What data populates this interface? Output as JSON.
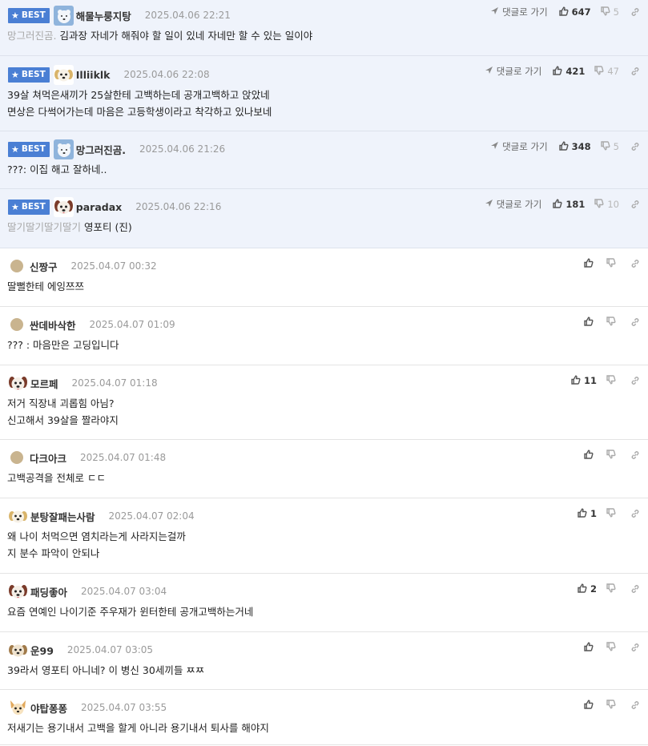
{
  "best_label": "BEST",
  "reply_label": "댓글로 가기",
  "comments": [
    {
      "best": true,
      "avatar": "polar-bear",
      "nickname": "해물누룽지탕",
      "date": "2025.04.06 22:21",
      "up": "647",
      "down": "5",
      "ref": "망그러진곰.",
      "lines": [
        "김과장 자네가 해줘야 할 일이 있네 자네만 할 수 있는 일이야"
      ]
    },
    {
      "best": true,
      "avatar": "puppy-white",
      "nickname": "Illiiklk",
      "date": "2025.04.06 22:08",
      "up": "421",
      "down": "47",
      "ref": "",
      "lines": [
        "39살 쳐먹은새끼가 25살한테 고백하는데 공개고백하고 앉았네",
        "면상은 다썩어가는데 마음은 고등학생이라고 착각하고 있나보네"
      ]
    },
    {
      "best": true,
      "avatar": "polar-bear",
      "nickname": "망그러진곰.",
      "date": "2025.04.06 21:26",
      "up": "348",
      "down": "5",
      "ref": "",
      "lines": [
        "???: 이집 해고 잘하네.."
      ]
    },
    {
      "best": true,
      "avatar": "dog-face",
      "nickname": "paradax",
      "date": "2025.04.06 22:16",
      "up": "181",
      "down": "10",
      "ref": "딸기딸기딸기딸기",
      "lines": [
        "영포티 (진)"
      ]
    },
    {
      "best": false,
      "avatar": "dot",
      "nickname": "신짱구",
      "date": "2025.04.07 00:32",
      "up": "",
      "down": "",
      "ref": "",
      "lines": [
        "딸뻘한테 에잉쯔쯔"
      ]
    },
    {
      "best": false,
      "avatar": "dot",
      "nickname": "싼데바삭한",
      "date": "2025.04.07 01:09",
      "up": "",
      "down": "",
      "ref": "",
      "lines": [
        "??? : 마음만은 고딩입니다"
      ]
    },
    {
      "best": false,
      "avatar": "dog-face",
      "nickname": "모르페",
      "date": "2025.04.07 01:18",
      "up": "11",
      "down": "",
      "ref": "",
      "lines": [
        "저거 직장내 괴롭힘 아님?",
        "신고해서 39살을 짤라야지"
      ]
    },
    {
      "best": false,
      "avatar": "dot",
      "nickname": "다크아크",
      "date": "2025.04.07 01:48",
      "up": "",
      "down": "",
      "ref": "",
      "lines": [
        "고백공격을 전체로 ㄷㄷ"
      ]
    },
    {
      "best": false,
      "avatar": "puppy-white",
      "nickname": "분탕잘패는사람",
      "date": "2025.04.07 02:04",
      "up": "1",
      "down": "",
      "ref": "",
      "lines": [
        "왜 나이 처먹으면 염치라는게 사라지는걸까",
        "지 분수 파악이 안되나"
      ]
    },
    {
      "best": false,
      "avatar": "dog-face",
      "nickname": "패딩좋아",
      "date": "2025.04.07 03:04",
      "up": "2",
      "down": "",
      "ref": "",
      "lines": [
        "요즘 연예인 나이기준 주우재가 윈터한테 공개고백하는거네"
      ]
    },
    {
      "best": false,
      "avatar": "puppy-brown",
      "nickname": "운99",
      "date": "2025.04.07 03:05",
      "up": "",
      "down": "",
      "ref": "",
      "lines": [
        "39라서 영포티 아니네? 이 병신 30세끼들 ㅉㅉ"
      ]
    },
    {
      "best": false,
      "avatar": "chihuahua",
      "nickname": "야탑퐁퐁",
      "date": "2025.04.07 03:55",
      "up": "",
      "down": "",
      "ref": "",
      "lines": [
        "저새기는 용기내서 고백을 할게 아니라 용기내서 퇴사를 해야지"
      ]
    }
  ]
}
